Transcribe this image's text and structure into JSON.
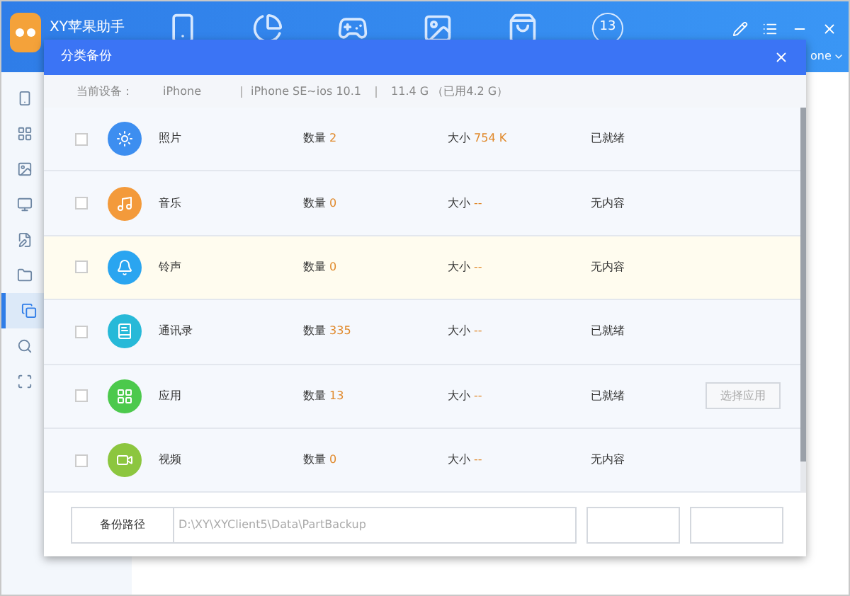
{
  "app": {
    "title": "XY苹果助手",
    "badge": "13",
    "device_fragment": "one"
  },
  "sidebar": {
    "items": [
      {
        "selected": false
      },
      {
        "selected": false
      },
      {
        "selected": false
      },
      {
        "selected": false
      },
      {
        "selected": false
      },
      {
        "selected": false
      },
      {
        "selected": true
      },
      {
        "selected": false
      },
      {
        "selected": false
      }
    ]
  },
  "dialog": {
    "title": "分类备份",
    "device_label": "当前设备：",
    "device_name": "iPhone",
    "model": "iPhone SE~ios 10.1",
    "storage": "11.4 G （已用4.2 G）",
    "rows": [
      {
        "kind": "photo",
        "name": "照片",
        "count_label": "数量",
        "count": "2",
        "size_label": "大小",
        "size": "754 K",
        "status": "已就绪",
        "checked": false,
        "highlighted": false
      },
      {
        "kind": "music",
        "name": "音乐",
        "count_label": "数量",
        "count": "0",
        "size_label": "大小",
        "size": "--",
        "status": "无内容",
        "checked": false,
        "highlighted": false
      },
      {
        "kind": "ringtone",
        "name": "铃声",
        "count_label": "数量",
        "count": "0",
        "size_label": "大小",
        "size": "--",
        "status": "无内容",
        "checked": false,
        "highlighted": true
      },
      {
        "kind": "contacts",
        "name": "通讯录",
        "count_label": "数量",
        "count": "335",
        "size_label": "大小",
        "size": "--",
        "status": "已就绪",
        "checked": false,
        "highlighted": false
      },
      {
        "kind": "apps",
        "name": "应用",
        "count_label": "数量",
        "count": "13",
        "size_label": "大小",
        "size": "--",
        "status": "已就绪",
        "checked": false,
        "highlighted": false,
        "action": "选择应用"
      },
      {
        "kind": "video",
        "name": "视频",
        "count_label": "数量",
        "count": "0",
        "size_label": "大小",
        "size": "--",
        "status": "无内容",
        "checked": false,
        "highlighted": false
      }
    ],
    "path_label": "备份路径",
    "path": "D:\\XY\\XYClient5\\Data\\PartBackup"
  }
}
